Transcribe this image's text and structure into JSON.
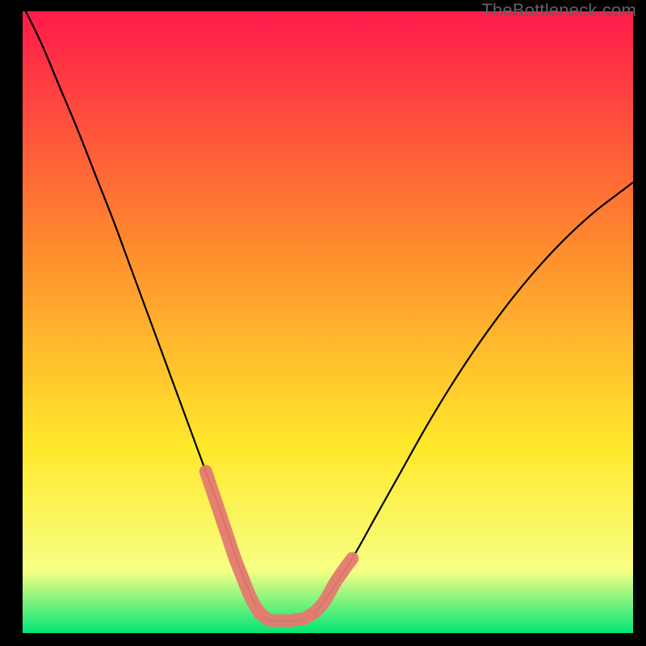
{
  "watermark": "TheBottleneck.com",
  "chart_data": {
    "type": "line",
    "title": "",
    "xlabel": "",
    "ylabel": "",
    "xlim": [
      0,
      100
    ],
    "ylim": [
      0,
      100
    ],
    "gradient": {
      "top": "#ff1a4b",
      "mid1": "#ff8c2e",
      "mid2": "#ffe82b",
      "mid3": "#f7ff84",
      "bottom": "#00e676"
    },
    "series": [
      {
        "name": "valley-curve",
        "stroke": "#000000",
        "x": [
          0,
          3,
          6,
          9,
          12,
          15,
          18,
          21,
          24,
          27,
          30,
          33,
          35,
          37,
          38.5,
          40,
          41,
          42,
          44,
          46,
          48,
          50,
          54,
          58,
          62,
          66,
          70,
          74,
          78,
          82,
          86,
          90,
          94,
          98,
          100
        ],
        "y": [
          101,
          95,
          88,
          81,
          73.5,
          66,
          58,
          50,
          42,
          34,
          26,
          18,
          12,
          7,
          4,
          2.3,
          2,
          2,
          2,
          2.3,
          3.5,
          6,
          12,
          19,
          26,
          33,
          39.5,
          45.5,
          51,
          56,
          60.5,
          64.5,
          68,
          71,
          72.5
        ]
      },
      {
        "name": "left-highlight",
        "stroke": "#e47a71",
        "x": [
          30,
          31.2,
          32.4,
          33.6,
          34.8,
          36,
          37,
          38,
          38.8
        ],
        "y": [
          26,
          22.5,
          19,
          15.5,
          12,
          9,
          6.5,
          4.5,
          3.3
        ]
      },
      {
        "name": "floor-highlight",
        "stroke": "#e47a71",
        "x": [
          38.8,
          40,
          41,
          42,
          43,
          44,
          45,
          46,
          47
        ],
        "y": [
          3.3,
          2.3,
          2,
          2,
          2,
          2,
          2.2,
          2.3,
          2.8
        ]
      },
      {
        "name": "right-highlight",
        "stroke": "#e47a71",
        "x": [
          47,
          48,
          49,
          50,
          51,
          52,
          53,
          54
        ],
        "y": [
          2.8,
          3.5,
          4.5,
          6,
          7.8,
          9.3,
          10.7,
          12
        ]
      }
    ]
  }
}
